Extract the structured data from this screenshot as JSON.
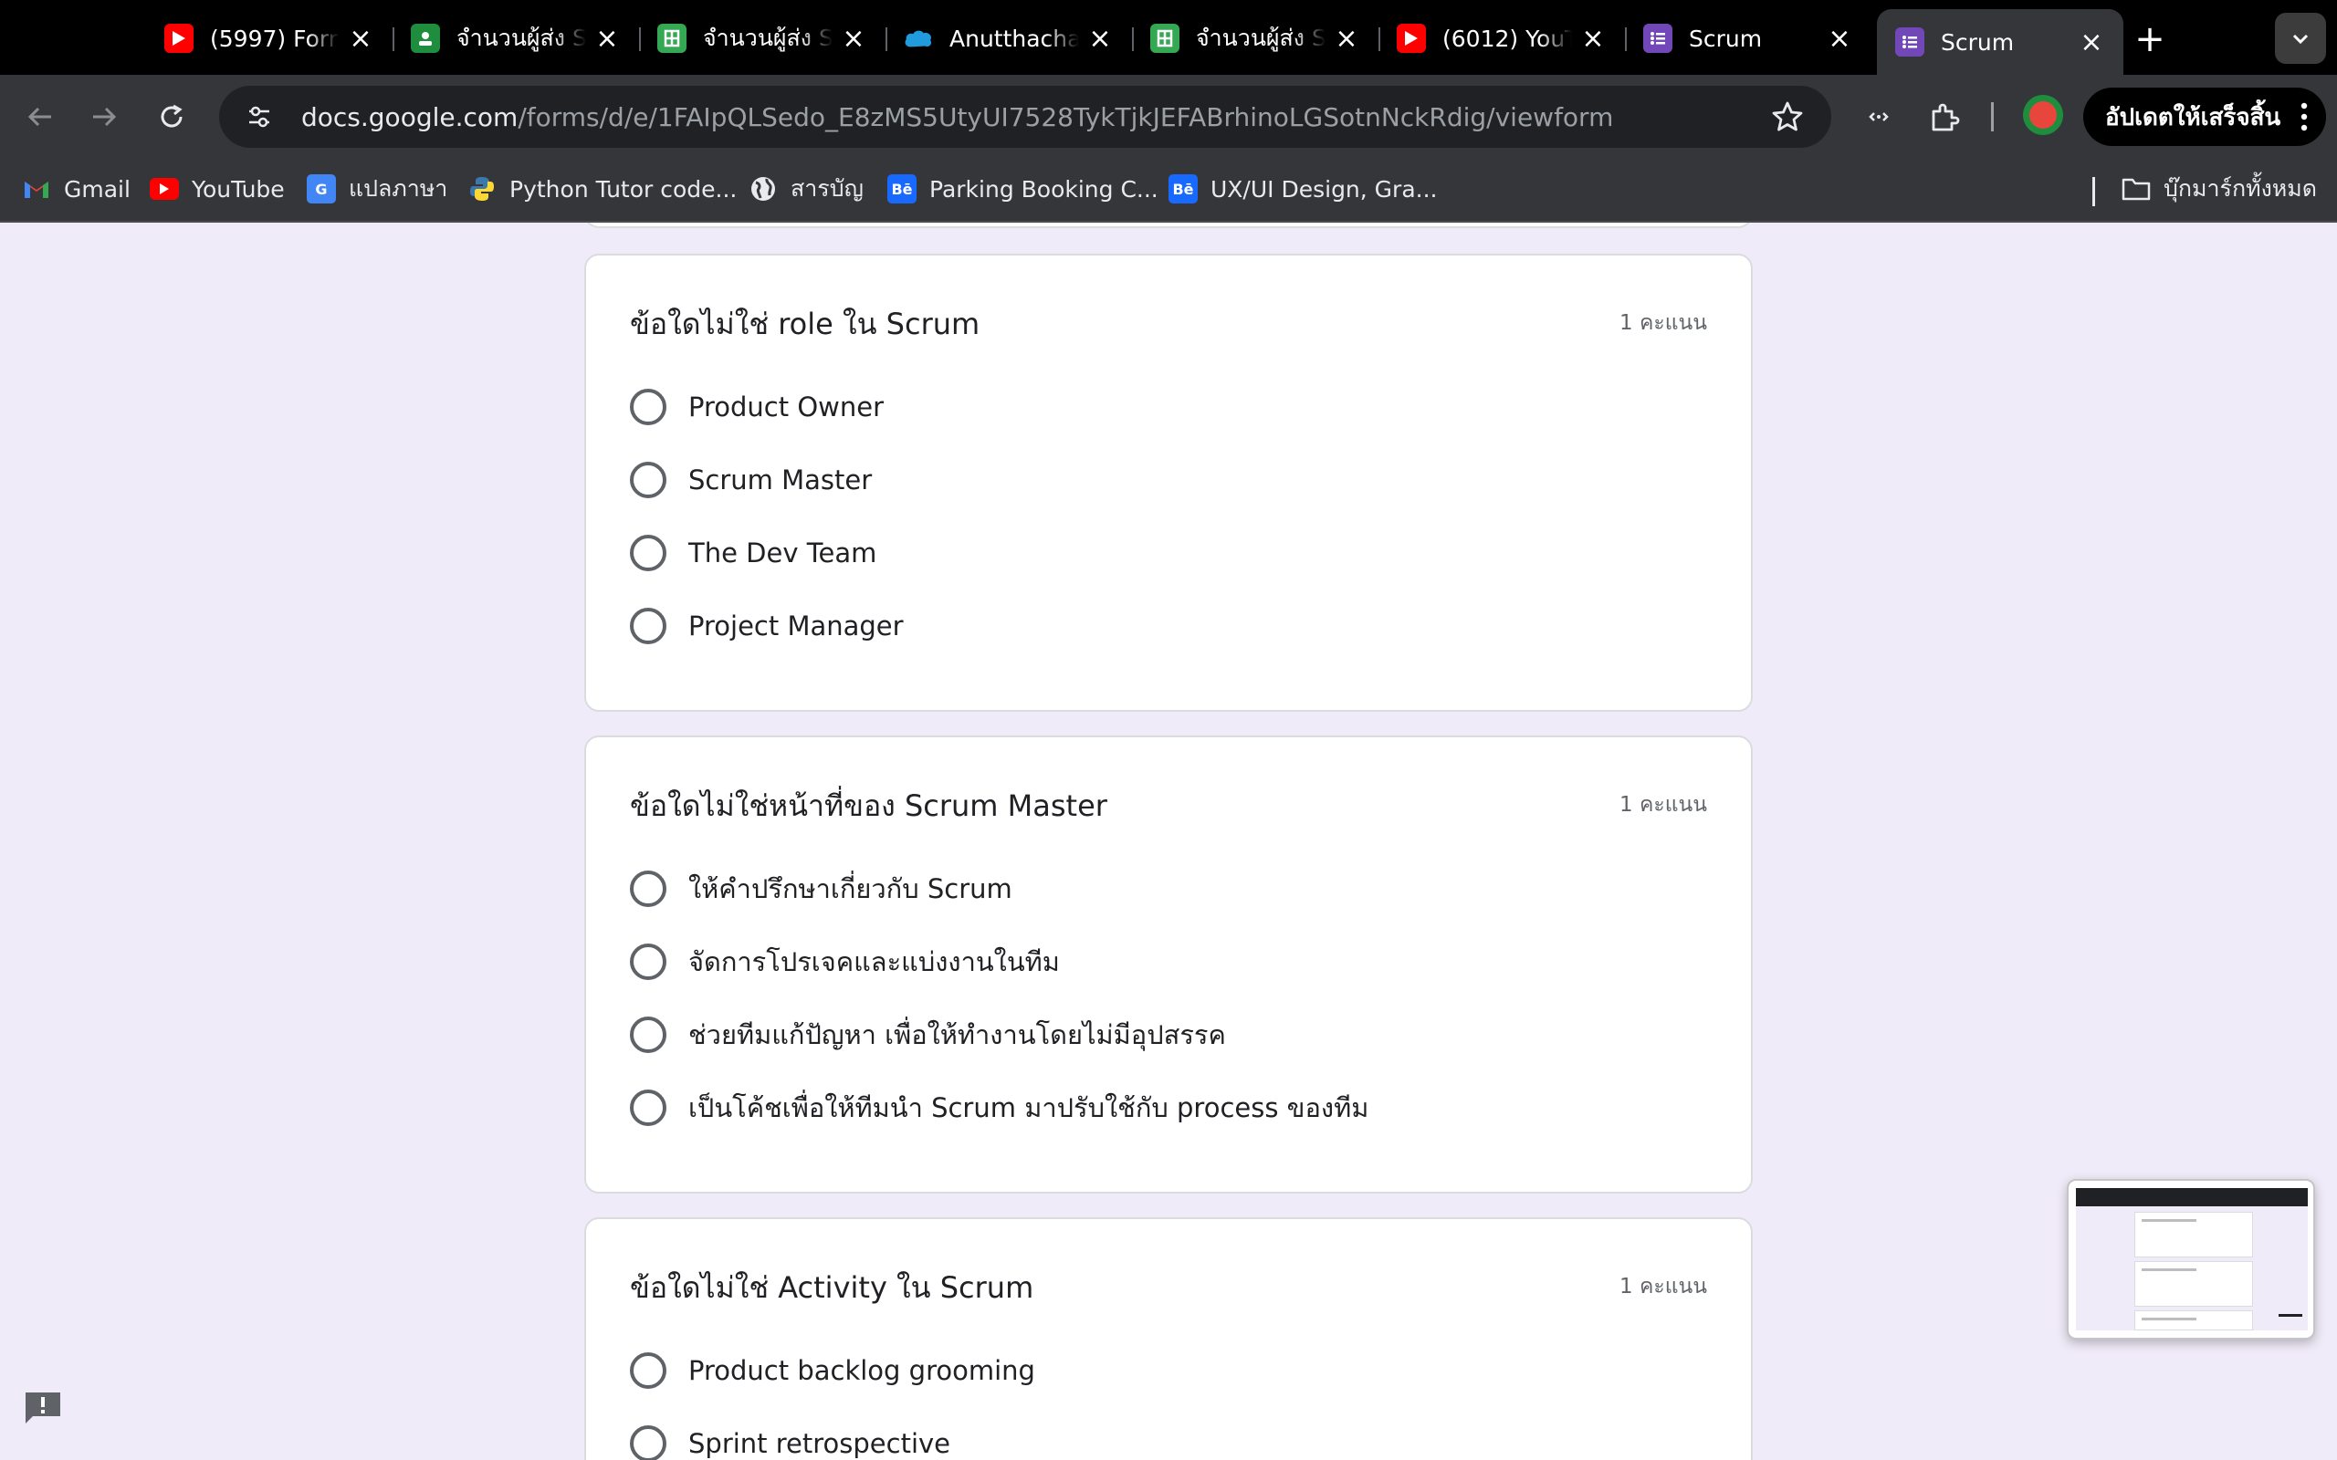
{
  "browser": {
    "tabs": [
      {
        "title": "(5997) Forr",
        "icon": "youtube-icon",
        "color": "#ff0000"
      },
      {
        "title": "จำนวนผู้ส่ง S",
        "icon": "google-classroom-icon",
        "color": "#1e8e3e"
      },
      {
        "title": "จำนวนผู้ส่ง S",
        "icon": "google-sheets-icon",
        "color": "#34a853"
      },
      {
        "title": "Anutthacha",
        "icon": "salesforce-cloud-icon",
        "color": "#1f9bde"
      },
      {
        "title": "จำนวนผู้ส่ง S",
        "icon": "google-sheets-icon",
        "color": "#34a853"
      },
      {
        "title": "(6012) YouT",
        "icon": "youtube-icon",
        "color": "#ff0000"
      },
      {
        "title": "Scrum",
        "icon": "google-forms-icon",
        "color": "#7248b9"
      },
      {
        "title": "Scrum",
        "icon": "google-forms-icon",
        "color": "#7248b9"
      }
    ],
    "active_tab_index": 7,
    "url_host": "docs.google.com",
    "url_path": "/forms/d/e/1FAIpQLSedo_E8zMS5UtyUI7528TykTjkJEFABrhinoLGSotnNckRdig/viewform",
    "update_button": "อัปเดตให้เสร็จสิ้น",
    "bookmarks": [
      {
        "label": "Gmail",
        "icon": "gmail-icon"
      },
      {
        "label": "YouTube",
        "icon": "youtube-icon"
      },
      {
        "label": "แปลภาษา",
        "icon": "google-translate-icon"
      },
      {
        "label": "Python Tutor code...",
        "icon": "python-icon"
      },
      {
        "label": "สารบัญ",
        "icon": "globe-icon"
      },
      {
        "label": "Parking Booking C...",
        "icon": "behance-icon"
      },
      {
        "label": "UX/UI Design, Gra...",
        "icon": "behance-icon"
      }
    ],
    "all_bookmarks": "บุ๊กมาร์กทั้งหมด"
  },
  "form": {
    "questions": [
      {
        "title": "ข้อใดไม่ใช่ role ใน Scrum",
        "points": "1 คะแนน",
        "options": [
          "Product Owner",
          "Scrum Master",
          "The Dev Team",
          "Project Manager"
        ]
      },
      {
        "title": "ข้อใดไม่ใช่หน้าที่ของ Scrum Master",
        "points": "1 คะแนน",
        "options": [
          "ให้คำปรึกษาเกี่ยวกับ Scrum",
          "จัดการโปรเจคและแบ่งงานในทีม",
          "ช่วยทีมแก้ปัญหา เพื่อให้ทำงานโดยไม่มีอุปสรรค",
          "เป็นโค้ชเพื่อให้ทีมนำ Scrum มาปรับใช้กับ process ของทีม"
        ]
      },
      {
        "title": "ข้อใดไม่ใช่ Activity ใน Scrum",
        "points": "1 คะแนน",
        "options": [
          "Product backlog grooming",
          "Sprint retrospective"
        ]
      }
    ]
  }
}
